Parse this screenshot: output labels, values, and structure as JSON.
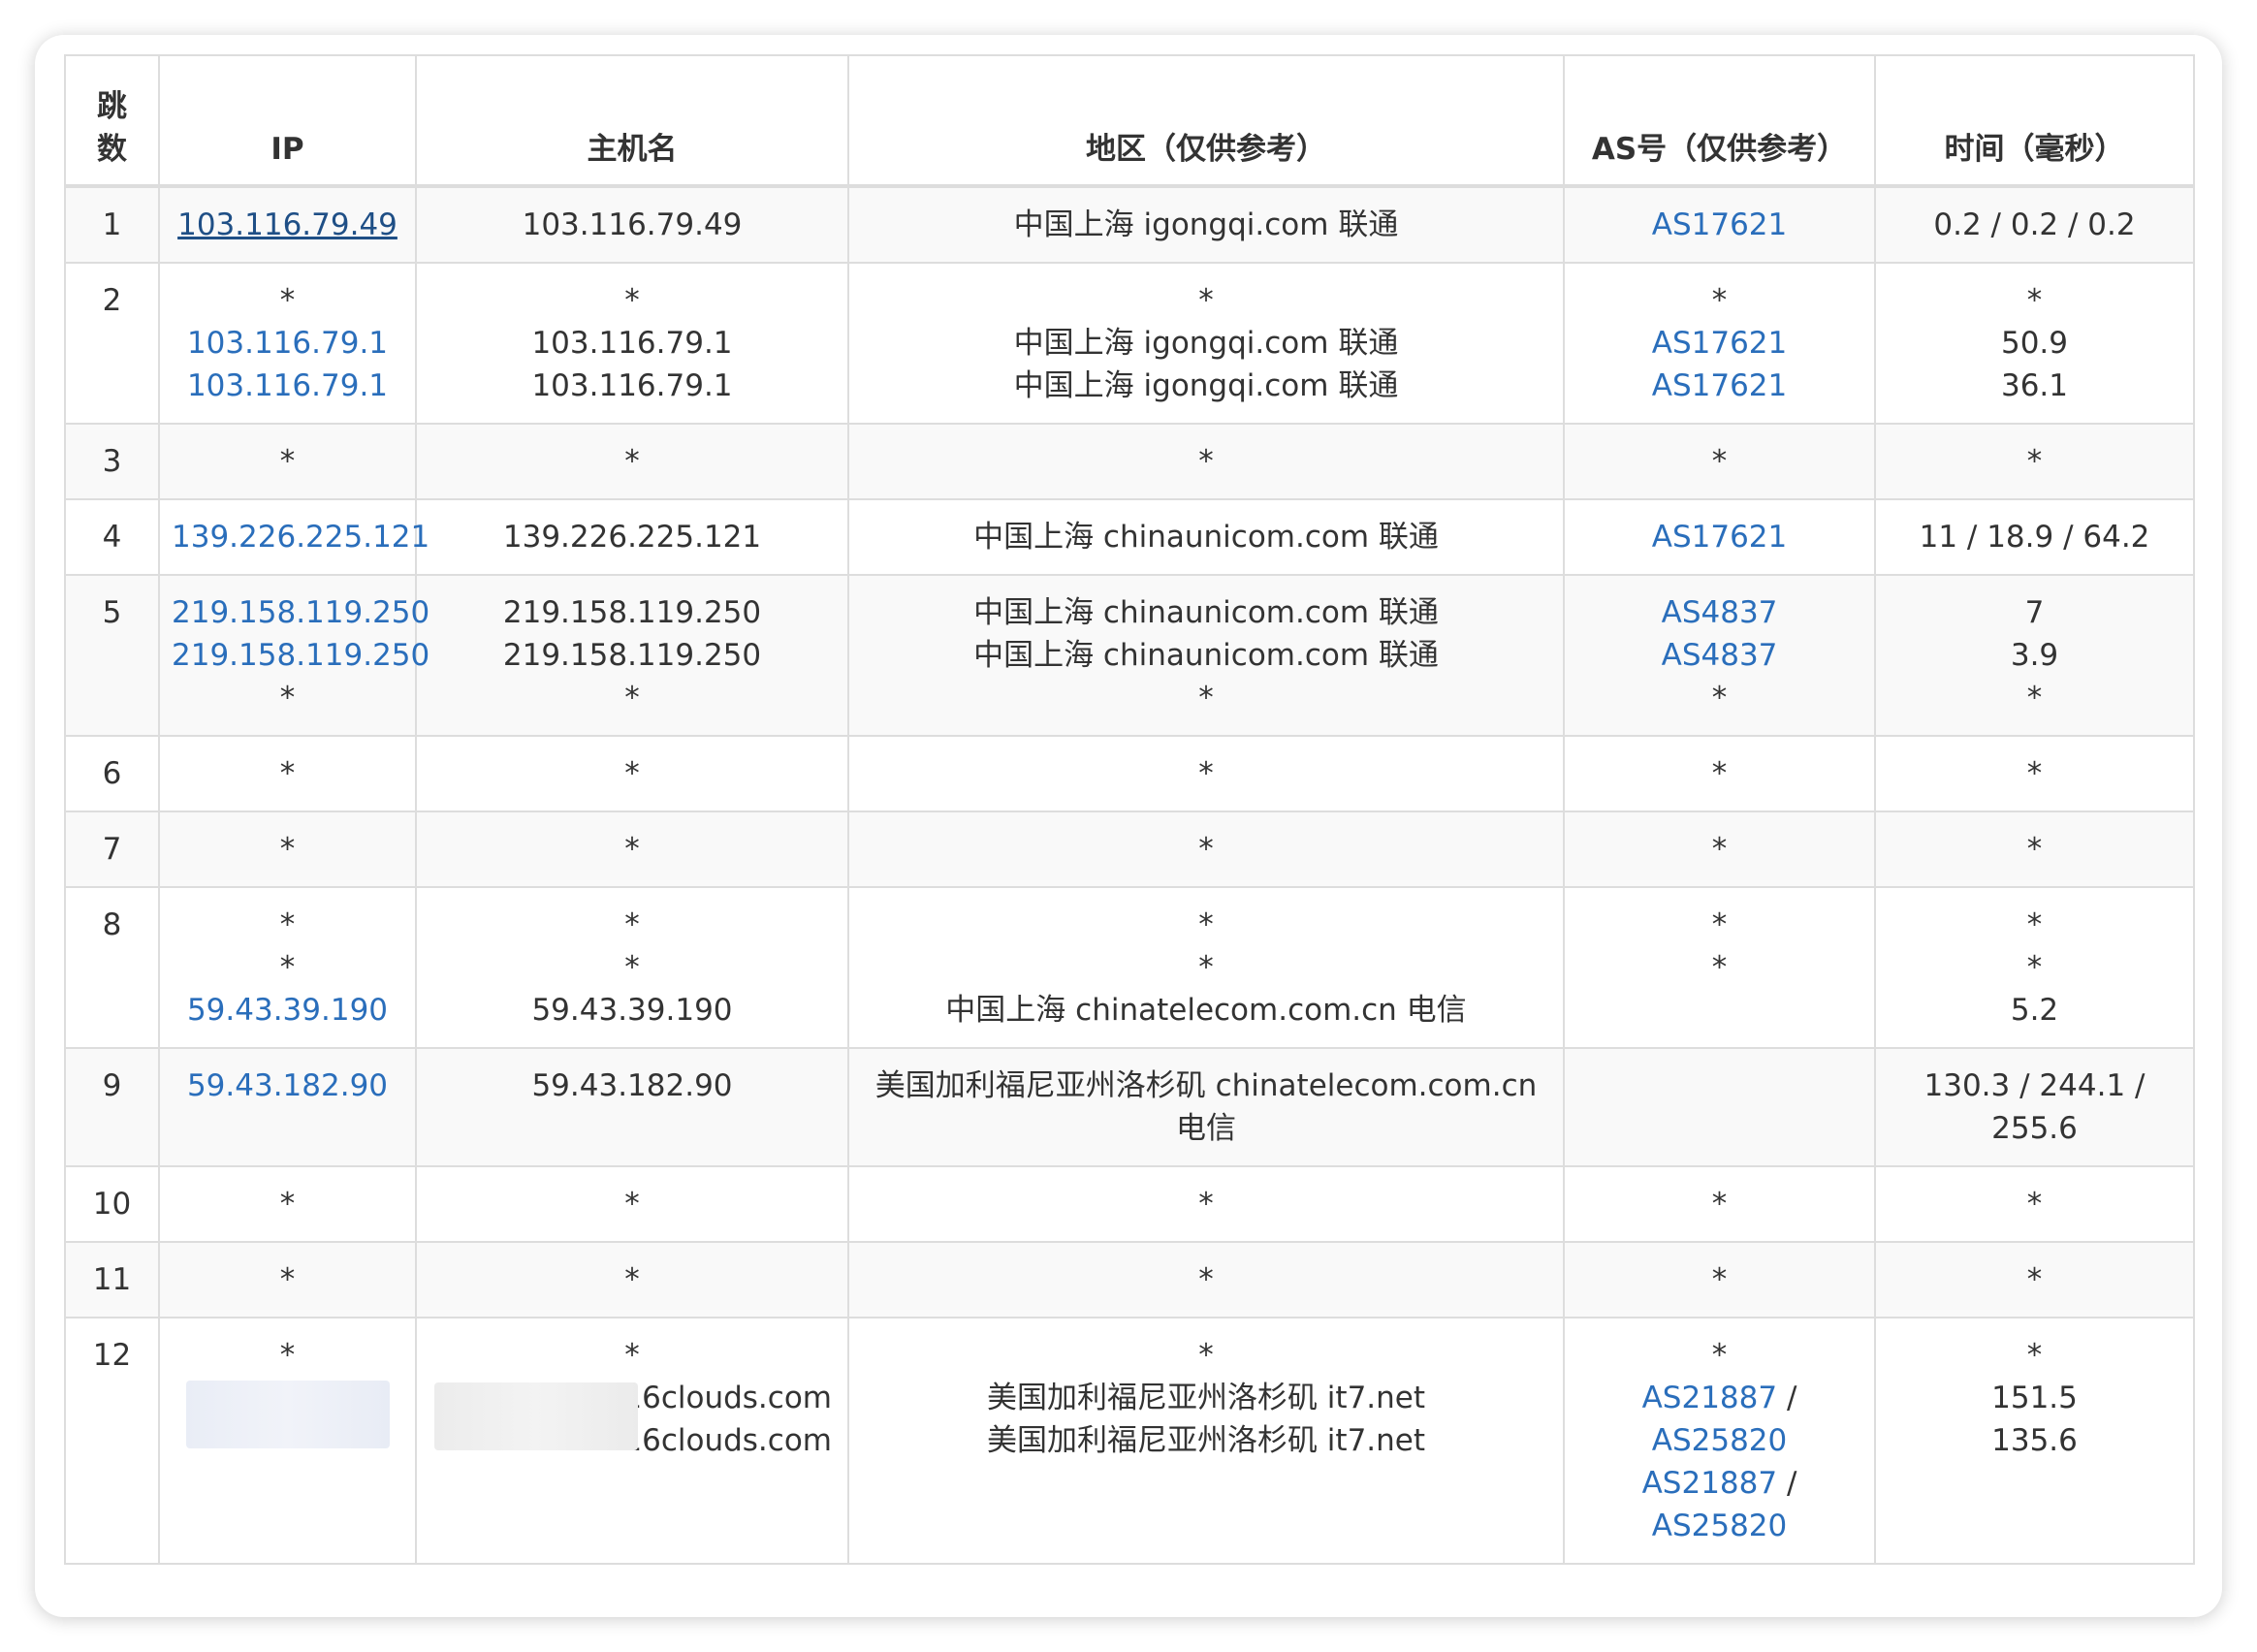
{
  "headers": {
    "hop": "跳数",
    "ip": "IP",
    "hostname": "主机名",
    "region": "地区（仅供参考）",
    "as": "AS号（仅供参考）",
    "time": "时间（毫秒）"
  },
  "rows": [
    {
      "hop": "1",
      "ip": [
        "103.116.79.49"
      ],
      "hostname": [
        "103.116.79.49"
      ],
      "region": [
        "中国上海 igongqi.com 联通"
      ],
      "as": [
        "AS17621"
      ],
      "time": [
        "0.2 / 0.2 / 0.2"
      ]
    },
    {
      "hop": "2",
      "ip": [
        "*",
        "103.116.79.1",
        "103.116.79.1"
      ],
      "hostname": [
        "*",
        "103.116.79.1",
        "103.116.79.1"
      ],
      "region": [
        "*",
        "中国上海 igongqi.com 联通",
        "中国上海 igongqi.com 联通"
      ],
      "as": [
        "*",
        "AS17621",
        "AS17621"
      ],
      "time": [
        "*",
        "50.9",
        "36.1"
      ]
    },
    {
      "hop": "3",
      "ip": [
        "*"
      ],
      "hostname": [
        "*"
      ],
      "region": [
        "*"
      ],
      "as": [
        "*"
      ],
      "time": [
        "*"
      ]
    },
    {
      "hop": "4",
      "ip": [
        "139.226.225.121"
      ],
      "hostname": [
        "139.226.225.121"
      ],
      "region": [
        "中国上海 chinaunicom.com 联通"
      ],
      "as": [
        "AS17621"
      ],
      "time": [
        "11 / 18.9 / 64.2"
      ]
    },
    {
      "hop": "5",
      "ip": [
        "219.158.119.250",
        "219.158.119.250",
        "*"
      ],
      "hostname": [
        "219.158.119.250",
        "219.158.119.250",
        "*"
      ],
      "region": [
        "中国上海 chinaunicom.com 联通",
        "中国上海 chinaunicom.com 联通",
        "*"
      ],
      "as": [
        "AS4837",
        "AS4837",
        "*"
      ],
      "time": [
        "7",
        "3.9",
        "*"
      ]
    },
    {
      "hop": "6",
      "ip": [
        "*"
      ],
      "hostname": [
        "*"
      ],
      "region": [
        "*"
      ],
      "as": [
        "*"
      ],
      "time": [
        "*"
      ]
    },
    {
      "hop": "7",
      "ip": [
        "*"
      ],
      "hostname": [
        "*"
      ],
      "region": [
        "*"
      ],
      "as": [
        "*"
      ],
      "time": [
        "*"
      ]
    },
    {
      "hop": "8",
      "ip": [
        "*",
        "*",
        "59.43.39.190"
      ],
      "hostname": [
        "*",
        "*",
        "59.43.39.190"
      ],
      "region": [
        "*",
        "*",
        "中国上海 chinatelecom.com.cn 电信"
      ],
      "as": [
        "*",
        "*"
      ],
      "time": [
        "*",
        "*",
        "5.2"
      ]
    },
    {
      "hop": "9",
      "ip": [
        "59.43.182.90"
      ],
      "hostname": [
        "59.43.182.90"
      ],
      "region": [
        "美国加利福尼亚州洛杉矶 chinatelecom.com.cn 电信"
      ],
      "as": [],
      "time": [
        "130.3 / 244.1 / 255.6"
      ]
    },
    {
      "hop": "10",
      "ip": [
        "*"
      ],
      "hostname": [
        "*"
      ],
      "region": [
        "*"
      ],
      "as": [
        "*"
      ],
      "time": [
        "*"
      ]
    },
    {
      "hop": "11",
      "ip": [
        "*"
      ],
      "hostname": [
        "*"
      ],
      "region": [
        "*"
      ],
      "as": [
        "*"
      ],
      "time": [
        "*"
      ]
    },
    {
      "hop": "12",
      "ip": [
        "*"
      ],
      "hostname": [
        "*",
        ".16clouds.com",
        ".16clouds.com"
      ],
      "region": [
        "*",
        "美国加利福尼亚州洛杉矶 it7.net",
        "美国加利福尼亚州洛杉矶 it7.net"
      ],
      "as": [
        "*",
        "AS21887",
        "/",
        "AS25820",
        "AS21887",
        "/",
        "AS25820"
      ],
      "time": [
        "*",
        "151.5",
        "135.6"
      ]
    }
  ]
}
